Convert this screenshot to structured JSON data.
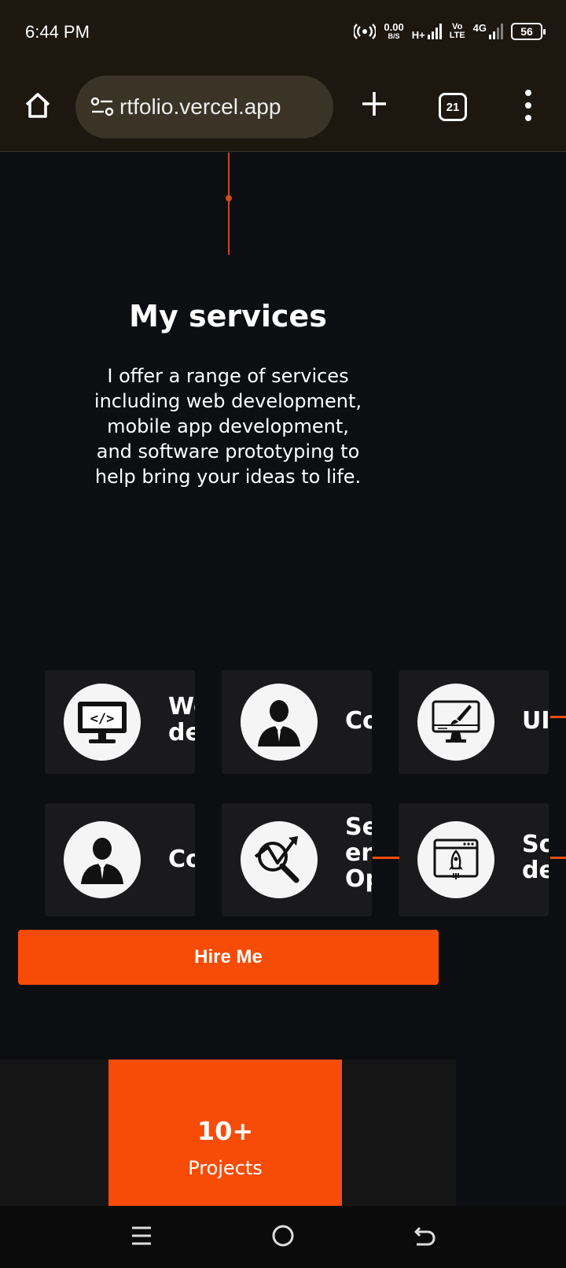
{
  "status_bar": {
    "time": "6:44 PM",
    "net_speed_value": "0.00",
    "net_speed_unit": "B/S",
    "network_type": "H+",
    "volte_top": "Vo",
    "volte_bottom": "LTE",
    "network_4g": "4G",
    "battery": "56"
  },
  "browser": {
    "url": "rtfolio.vercel.app",
    "tab_count": "21"
  },
  "services": {
    "title": "My services",
    "description": "I offer a range of services including web development, mobile app development, and software prototyping to help bring your ideas to life.",
    "cards": [
      {
        "label": "Web\ndev",
        "icon": "web-dev-icon"
      },
      {
        "label": "Cons",
        "icon": "consultant-icon"
      },
      {
        "label": "UI/U",
        "icon": "ui-design-icon"
      },
      {
        "label": "Cons",
        "icon": "consultant-icon"
      },
      {
        "label": "Sear\nengi\nOpti",
        "icon": "seo-icon"
      },
      {
        "label": "Sof\ndep",
        "icon": "rocket-deploy-icon"
      }
    ],
    "hire_button": "Hire Me"
  },
  "stats": {
    "value": "10+",
    "label": "Projects"
  },
  "colors": {
    "accent": "#f74c08",
    "background": "#0d0e12",
    "card": "#1a1a1d",
    "browser_chrome": "#1d1710"
  }
}
